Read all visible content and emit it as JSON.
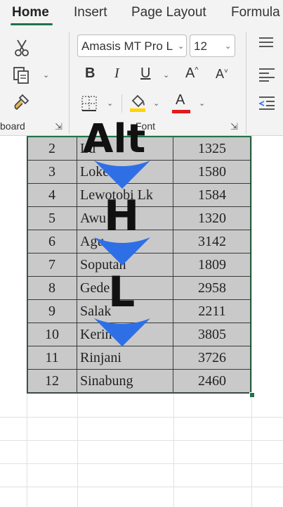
{
  "tabs": {
    "home": "Home",
    "insert": "Insert",
    "page_layout": "Page Layout",
    "formulas": "Formula"
  },
  "ribbon": {
    "font_name": "Amasis MT Pro L",
    "font_size": "12",
    "bold": "B",
    "italic": "I",
    "underline": "U",
    "grow_font": "A",
    "shrink_font": "A",
    "font_color_letter": "A",
    "clipboard_label": "board",
    "font_label": "Font",
    "accent_color": "#217346",
    "font_color": "#e21b1b",
    "fill_color": "#ffd400"
  },
  "keystrokes": [
    "Alt",
    "H",
    "L"
  ],
  "table": {
    "rows": [
      {
        "no": "2",
        "name": "Lu",
        "value": "1325"
      },
      {
        "no": "3",
        "name": "Loke",
        "value": "1580"
      },
      {
        "no": "4",
        "name": "Lewotobi Lk",
        "value": "1584"
      },
      {
        "no": "5",
        "name": "Awu",
        "value": "1320"
      },
      {
        "no": "6",
        "name": "Agu",
        "value": "3142"
      },
      {
        "no": "7",
        "name": "Soputan",
        "value": "1809"
      },
      {
        "no": "8",
        "name": "Gede",
        "value": "2958"
      },
      {
        "no": "9",
        "name": "Salak",
        "value": "2211"
      },
      {
        "no": "10",
        "name": "Kerin",
        "value": "3805"
      },
      {
        "no": "11",
        "name": "Rinjani",
        "value": "3726"
      },
      {
        "no": "12",
        "name": "Sinabung",
        "value": "2460"
      }
    ]
  },
  "overlay_color": "#2f6fe6"
}
